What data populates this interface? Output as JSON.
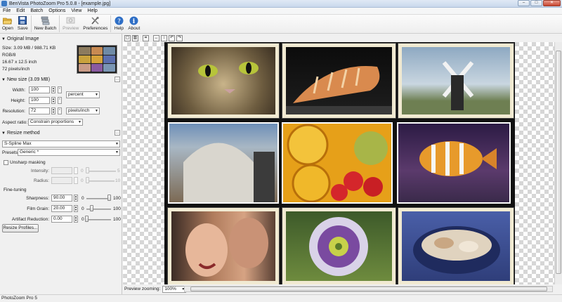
{
  "window": {
    "title": "BenVista PhotoZoom Pro 5.0.8 - [example.jpg]"
  },
  "menu": [
    "File",
    "Edit",
    "Batch",
    "Options",
    "View",
    "Help"
  ],
  "toolbar": {
    "open": "Open",
    "save": "Save",
    "new_batch": "New Batch",
    "preview": "Preview",
    "preferences": "Preferences",
    "help": "Help",
    "about": "About"
  },
  "original_image": {
    "header": "Original Image",
    "size": "Size: 3.09 MB / 988.71 KB",
    "mode": "RGB/8",
    "dimensions": "16.67 x 12.5 inch",
    "resolution": "72 pixels/inch"
  },
  "new_size": {
    "header": "New size (3.09 MB)",
    "width_label": "Width:",
    "width_value": "100",
    "height_label": "Height:",
    "height_value": "100",
    "unit": "percent",
    "resolution_label": "Resolution:",
    "resolution_value": "72",
    "resolution_unit": "pixels/inch",
    "aspect_label": "Aspect ratio:",
    "aspect_value": "Constrain proportions"
  },
  "resize_method": {
    "header": "Resize method",
    "method": "S-Spline Max",
    "presets_label": "Presets:",
    "preset": "Generic *"
  },
  "unsharp": {
    "label": "Unsharp masking",
    "intensity_label": "Intensity:",
    "intensity_min": "0",
    "intensity_max": "5",
    "radius_label": "Radius:",
    "radius_min": "0",
    "radius_max": "10"
  },
  "fine_tuning": {
    "label": "Fine-tuning",
    "sharpness_label": "Sharpness:",
    "sharpness_value": "90.00",
    "sharpness_min": "0",
    "sharpness_max": "100",
    "sharpness_level": 0.9,
    "grain_label": "Film Grain:",
    "grain_value": "20.00",
    "grain_min": "0",
    "grain_max": "100",
    "grain_level": 0.2,
    "artifact_label": "Artifact Reduction:",
    "artifact_value": "0.00",
    "artifact_min": "0",
    "artifact_max": "100",
    "artifact_level": 0
  },
  "resize_profiles_button": "Resize Profiles...",
  "preview_zoom": {
    "label": "Preview zooming:",
    "value": "100%"
  },
  "status": "PhotoZoom Pro 5",
  "colors": {
    "accent": "#3b79c4",
    "canvas_bg": "#111111"
  },
  "icons": [
    "open-folder-icon",
    "save-disk-icon",
    "new-batch-icon",
    "preview-icon",
    "preferences-tools-icon",
    "help-icon",
    "about-info-icon"
  ]
}
